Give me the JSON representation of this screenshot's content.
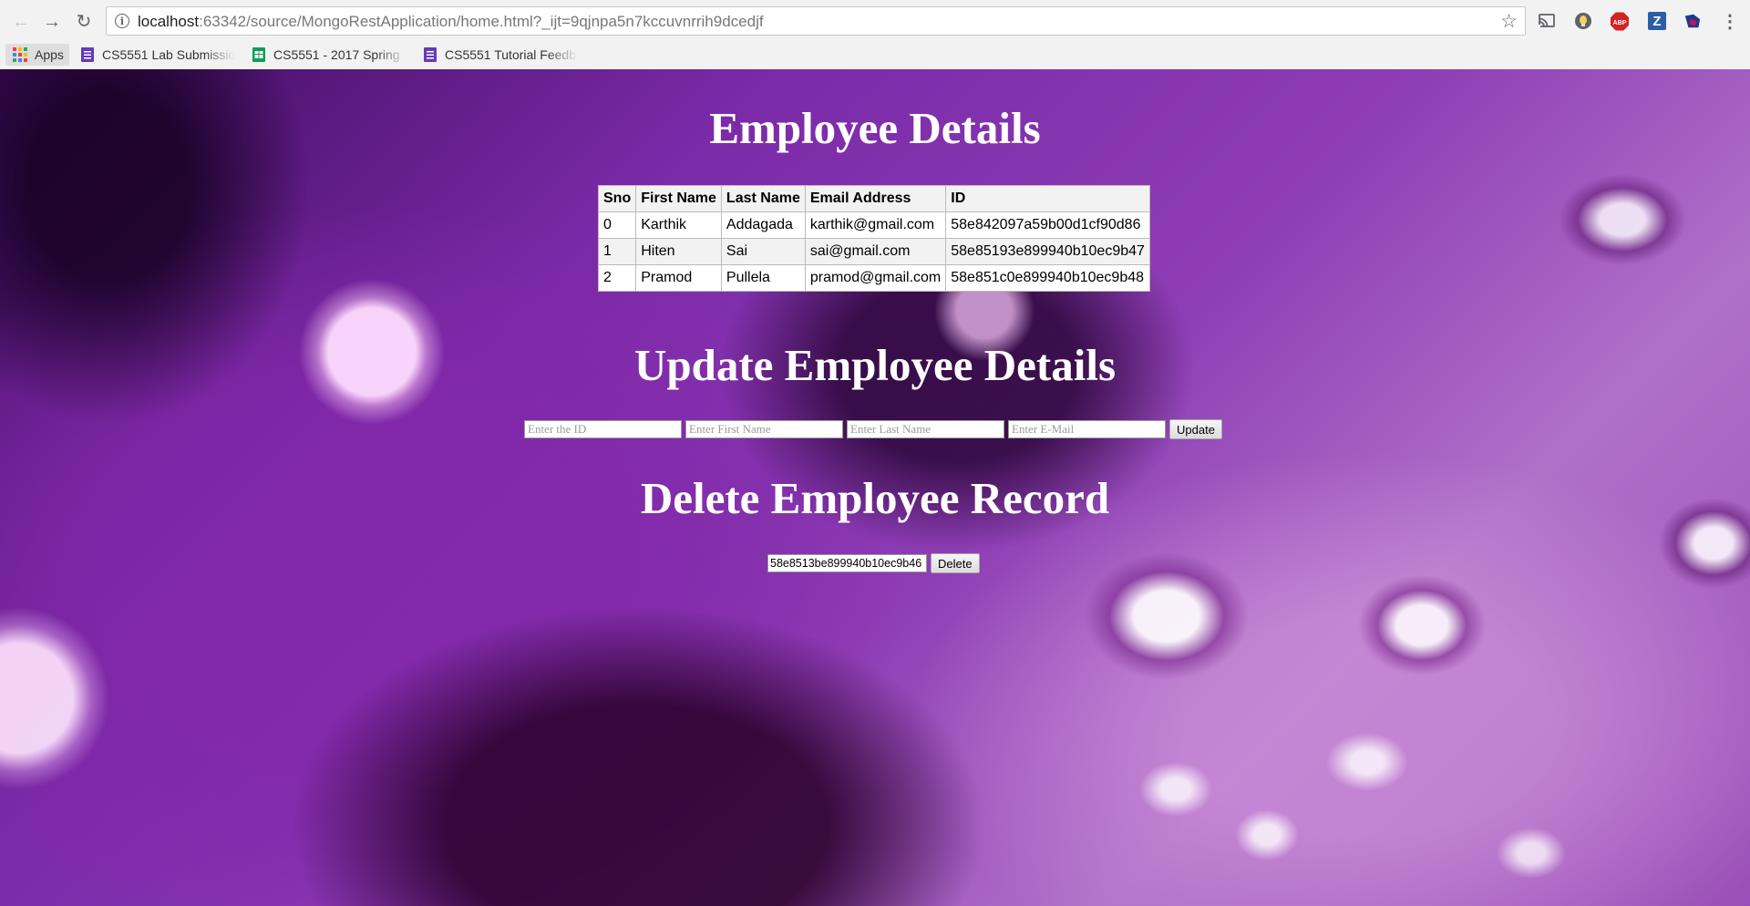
{
  "browser": {
    "url_host": "localhost",
    "url_rest": ":63342/source/MongoRestApplication/home.html?_ijt=9qjnpa5n7kccuvnrrih9dcedjf",
    "bookmarks": [
      {
        "label": "Apps"
      },
      {
        "label": "CS5551 Lab Submissio"
      },
      {
        "label": "CS5551 - 2017 Spring"
      },
      {
        "label": "CS5551 Tutorial Feedb"
      }
    ],
    "extensions": [
      {
        "name": "cast-icon"
      },
      {
        "name": "lightbulb-extension-icon"
      },
      {
        "name": "adblock-plus-icon",
        "text": "ABP",
        "color": "#d42121"
      },
      {
        "name": "zotero-icon",
        "text": "Z",
        "color": "#2b5ea6"
      },
      {
        "name": "puzzle-extension-icon"
      },
      {
        "name": "menu-icon"
      }
    ]
  },
  "page": {
    "employee_heading": "Employee Details",
    "table": {
      "headers": [
        "Sno",
        "First Name",
        "Last Name",
        "Email Address",
        "ID"
      ],
      "rows": [
        [
          "0",
          "Karthik",
          "Addagada",
          "karthik@gmail.com",
          "58e842097a59b00d1cf90d86"
        ],
        [
          "1",
          "Hiten",
          "Sai",
          "sai@gmail.com",
          "58e85193e899940b10ec9b47"
        ],
        [
          "2",
          "Pramod",
          "Pullela",
          "pramod@gmail.com",
          "58e851c0e899940b10ec9b48"
        ]
      ]
    },
    "update_heading": "Update Employee Details",
    "update_form": {
      "id_placeholder": "Enter the ID",
      "first_placeholder": "Enter First Name",
      "last_placeholder": "Enter Last Name",
      "email_placeholder": "Enter E-Mail",
      "button": "Update"
    },
    "delete_heading": "Delete Employee Record",
    "delete_form": {
      "id_value": "58e8513be899940b10ec9b46",
      "button": "Delete"
    }
  }
}
